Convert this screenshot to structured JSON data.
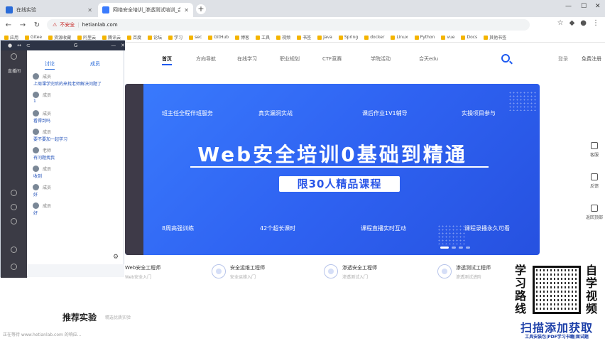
{
  "browser": {
    "tabs": [
      {
        "title": "在线实验",
        "active": false,
        "favicon_color": "#2a6bd8"
      },
      {
        "title": "网络安全培训_渗透测试培训_合天网安实验室",
        "active": true,
        "favicon_color": "#3a7bfd"
      }
    ],
    "address": {
      "security_label": "不安全",
      "url": "hetianlab.com"
    },
    "bookmarks": [
      "应用",
      "Gitee",
      "资源收藏",
      "阿里云",
      "腾讯云",
      "百度",
      "论坛",
      "学习",
      "sec",
      "GitHub",
      "博客",
      "工具",
      "视频",
      "书签",
      "Java",
      "Spring",
      "docker",
      "Linux",
      "Python",
      "vue",
      "Docs",
      "其他书签"
    ]
  },
  "site": {
    "nav": [
      "首页",
      "方向导航",
      "在线学习",
      "职业规划",
      "CTF竞赛",
      "学院活动",
      "合天edu"
    ],
    "login": "登录",
    "register": "免费注册",
    "banner": {
      "features_top": [
        "班主任全程伴班服务",
        "真实漏洞实战",
        "课后作业1V1辅导",
        "实操项目参与"
      ],
      "title": "Web安全培训0基础到精通",
      "subtitle": "限30人精品课程",
      "features_bottom": [
        "8周高强训练",
        "42个超长课时",
        "课程直播实时互动",
        "课程录播永久可看"
      ]
    },
    "paths": [
      {
        "title": "Web安全工程师",
        "sub": "Web安全入门"
      },
      {
        "title": "安全运维工程师",
        "sub": "安全运维入门"
      },
      {
        "title": "渗透安全工程师",
        "sub": "渗透测试入门"
      },
      {
        "title": "渗透测试工程师",
        "sub": "渗透测试进阶"
      }
    ],
    "recommend": {
      "title": "推荐实验",
      "sub": "精选优质实验"
    },
    "rightbar": [
      "客服",
      "反馈",
      "返回顶部"
    ]
  },
  "chat": {
    "rail_label": "直播间",
    "tabs": [
      "讨论",
      "成员"
    ],
    "messages": [
      {
        "name": "成员",
        "text": "上周课学完后的来找老师解决问题了"
      },
      {
        "name": "成员",
        "text": "1"
      },
      {
        "name": "成员",
        "text": "看得到吗"
      },
      {
        "name": "成员",
        "text": "要不要加一起学习"
      },
      {
        "name": "老师",
        "text": "有问题找我"
      },
      {
        "name": "成员",
        "text": "收到"
      },
      {
        "name": "成员",
        "text": "好"
      },
      {
        "name": "成员",
        "text": "好"
      }
    ]
  },
  "notice": "正在等待 www.hetianlab.com 的响应...",
  "promo": {
    "left_text": "学习路线",
    "right_text": "自学视频",
    "main": "扫描添加获取",
    "tags": "工具安装包|PDF学习书籍|面试题"
  }
}
